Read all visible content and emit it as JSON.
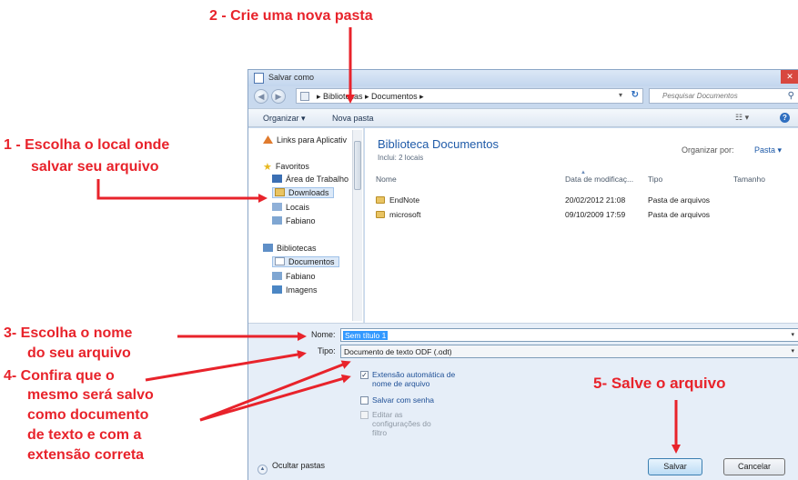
{
  "annotations": {
    "step2": "2 - Crie uma nova pasta",
    "step1_line1": "1 - Escolha o local onde",
    "step1_line2": "salvar seu arquivo",
    "step3_line1": "3-  Escolha o nome",
    "step3_line2": "do seu arquivo",
    "step4_line1": "4-  Confira que o",
    "step4_line2": "mesmo será salvo",
    "step4_line3": "como documento",
    "step4_line4": "de texto e com a",
    "step4_line5": "extensão correta",
    "step5": "5-  Salve o arquivo",
    "arrow_color": "#e8232b"
  },
  "dialog": {
    "title": "Salvar como",
    "breadcrumb": "▸ Bibliotecas ▸ Documentos ▸",
    "search_placeholder": "Pesquisar Documentos",
    "toolbar": {
      "organize": "Organizar ▾",
      "new_folder": "Nova pasta"
    },
    "sidebar": {
      "items": [
        {
          "label": "Links para Aplicativ",
          "icon": "links-icon"
        },
        {
          "label": "Favoritos",
          "icon": "star-icon"
        },
        {
          "label": "Área de Trabalho",
          "icon": "desktop-icon"
        },
        {
          "label": "Downloads",
          "icon": "downloads-icon"
        },
        {
          "label": "Locais",
          "icon": "places-icon"
        },
        {
          "label": "Fabiano",
          "icon": "user-folder-icon"
        },
        {
          "label": "Bibliotecas",
          "icon": "libraries-icon"
        },
        {
          "label": "Documentos",
          "icon": "documents-icon"
        },
        {
          "label": "Fabiano",
          "icon": "user-folder-icon"
        },
        {
          "label": "Imagens",
          "icon": "images-icon"
        }
      ]
    },
    "library": {
      "title": "Biblioteca Documentos",
      "includes": "Inclui: 2 locais",
      "organize_by_label": "Organizar por:",
      "organize_by_value": "Pasta ▾"
    },
    "columns": [
      "Nome",
      "Data de modificaç...",
      "Tipo",
      "Tamanho"
    ],
    "files": [
      {
        "name": "EndNote",
        "date": "20/02/2012 21:08",
        "type": "Pasta de arquivos"
      },
      {
        "name": "microsoft",
        "date": "09/10/2009 17:59",
        "type": "Pasta de arquivos"
      }
    ],
    "form": {
      "name_label": "Nome:",
      "name_value": "Sem título 1",
      "type_label": "Tipo:",
      "type_value": "Documento de texto ODF (.odt)",
      "auto_ext": "Extensão automática de nome de arquivo",
      "auto_ext_checked": "✓",
      "save_password": "Salvar com senha",
      "edit_filter": "Editar as configurações do filtro"
    },
    "buttons": {
      "hide_folders": "Ocultar pastas",
      "save": "Salvar",
      "cancel": "Cancelar"
    }
  }
}
